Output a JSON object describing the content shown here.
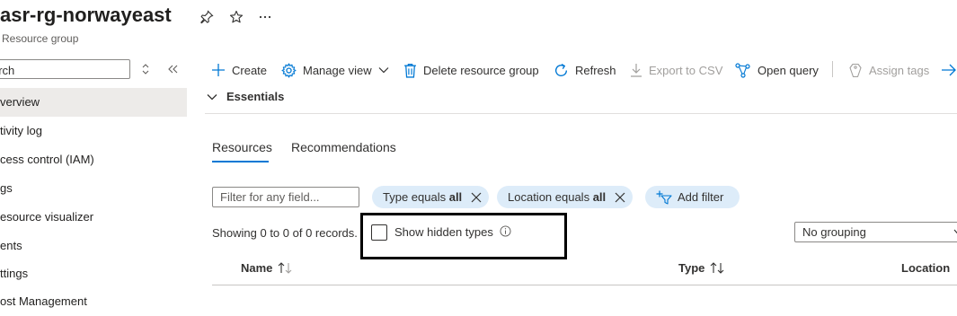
{
  "header": {
    "title": "asr-rg-norwayeast",
    "subtitle": "Resource group",
    "icons": [
      "pin-icon",
      "star-icon",
      "more-icon"
    ]
  },
  "sidebar": {
    "search_placeholder": "arch",
    "items": [
      {
        "label": "verview",
        "active": true
      },
      {
        "label": "tivity log"
      },
      {
        "label": "cess control (IAM)"
      },
      {
        "label": "gs"
      },
      {
        "label": "esource visualizer"
      },
      {
        "label": "ents"
      },
      {
        "label": "ttings"
      },
      {
        "label": "ost Management"
      }
    ]
  },
  "toolbar": {
    "create": "Create",
    "manage_view": "Manage view",
    "delete_rg": "Delete resource group",
    "refresh": "Refresh",
    "export_csv": "Export to CSV",
    "open_query": "Open query",
    "assign_tags": "Assign tags"
  },
  "essentials": {
    "label": "Essentials"
  },
  "tabs": [
    {
      "label": "Resources",
      "selected": true
    },
    {
      "label": "Recommendations",
      "selected": false
    }
  ],
  "filters": {
    "field_placeholder": "Filter for any field...",
    "type_pill": {
      "prefix": "Type equals ",
      "value": "all"
    },
    "location_pill": {
      "prefix": "Location equals ",
      "value": "all"
    },
    "add_filter": "Add filter"
  },
  "records_text": "Showing 0 to 0 of 0 records.",
  "show_hidden_types": {
    "label": "Show hidden types",
    "checked": false
  },
  "grouping": {
    "selected": "No grouping"
  },
  "columns": {
    "name": "Name",
    "type": "Type",
    "location": "Location"
  },
  "colors": {
    "accent": "#0078d4",
    "pill_bg": "#ddecf9",
    "selected_nav": "#edebe9"
  }
}
